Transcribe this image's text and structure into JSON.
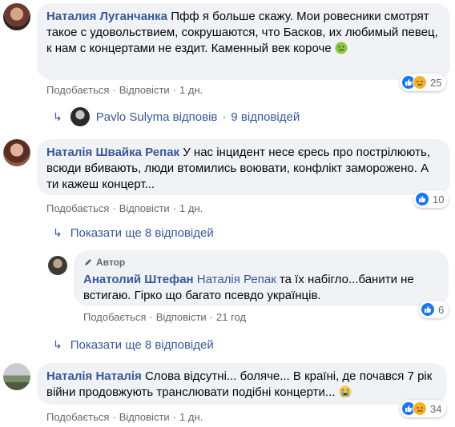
{
  "comments": [
    {
      "author": "Наталия Луганчанка",
      "text": "Пфф я больше скажу. Мои ровесники смотрят такое с удовольствием, сокрушаются, что Басков, их любимый певец, к нам с концертами не ездит. Каменный век короче",
      "like_label": "Подобається",
      "reply_label": "Відповісти",
      "time": "1 дн.",
      "reaction_count": "25",
      "reactions": [
        "like-icon",
        "sad-icon"
      ],
      "emoji": "nauseated-face-emoji"
    },
    {
      "author": "Наталія Швайка Репак",
      "text": "У нас інцидент несе єресь про пострілюють, всюди вбивають, люди втомились воювати, конфлікт заморожено. А ти кажеш концерт...",
      "like_label": "Подобається",
      "reply_label": "Відповісти",
      "time": "1 дн.",
      "reaction_count": "10",
      "reactions": [
        "like-icon"
      ]
    },
    {
      "author": "Анатолий Штефан",
      "badge": "Автор",
      "mention": "Наталія Репак",
      "text": "та їх набігло...банити не встигаю. Гірко що багато псевдо українців.",
      "like_label": "Подобається",
      "reply_label": "Відповісти",
      "time": "21 год",
      "reaction_count": "6",
      "reactions": [
        "like-icon"
      ]
    },
    {
      "author": "Наталія Наталія",
      "text": "Слова відсутні... боляче... В країні, де почався 7 рік війни продовжують транслювати подібні концерти...",
      "like_label": "Подобається",
      "reply_label": "Відповісти",
      "time": "1 дн.",
      "reaction_count": "34",
      "reactions": [
        "like-icon",
        "sad-icon"
      ],
      "emoji": "crying-face-emoji"
    }
  ],
  "reply_thread_1": {
    "name": "Pavlo Sulyma відповів",
    "count": "9 відповідей"
  },
  "show_more_1": "Показати ще 8 відповідей",
  "show_more_2": "Показати ще 8 відповідей",
  "colors": {
    "link": "#385898",
    "bubble": "#f0f2f5",
    "meta": "#65676b",
    "like": "#1877f2",
    "sad": "#f7b125"
  }
}
